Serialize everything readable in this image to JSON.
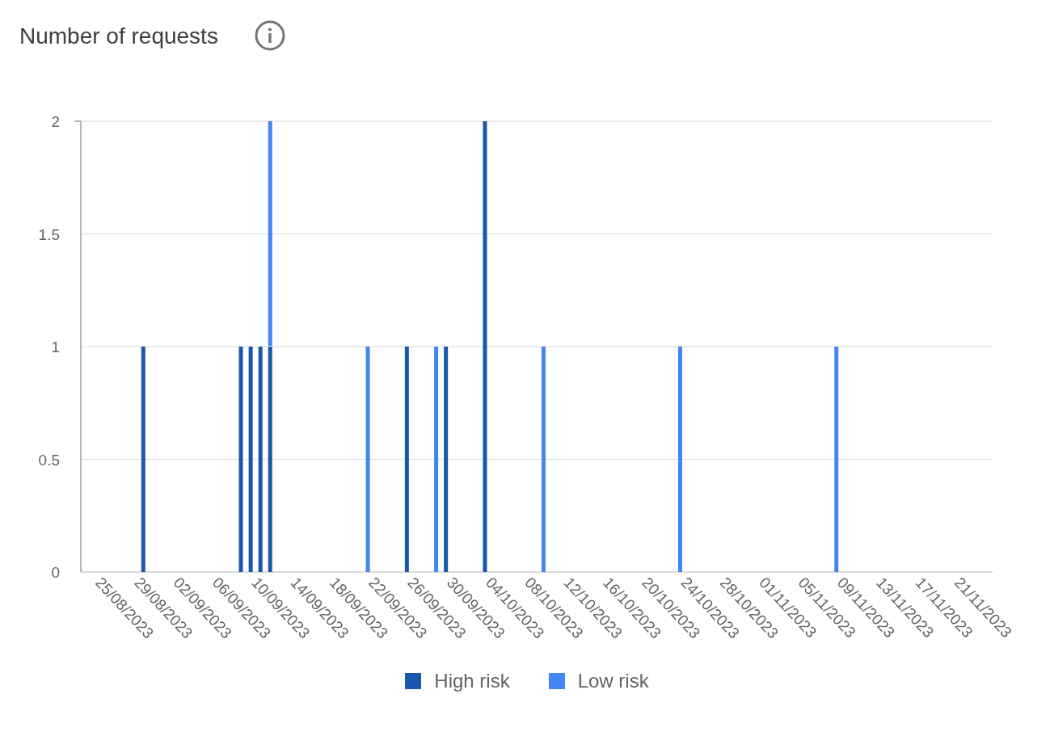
{
  "title": "Number of requests",
  "chart_data": {
    "type": "bar",
    "stacked": true,
    "grid": true,
    "categories": [
      "25/08/2023",
      null,
      null,
      null,
      "29/08/2023",
      null,
      null,
      null,
      "02/09/2023",
      null,
      null,
      null,
      "06/09/2023",
      null,
      null,
      null,
      "10/09/2023",
      null,
      null,
      null,
      "14/09/2023",
      null,
      null,
      null,
      "18/09/2023",
      null,
      null,
      null,
      "22/09/2023",
      null,
      null,
      null,
      "26/09/2023",
      null,
      null,
      null,
      "30/09/2023",
      null,
      null,
      null,
      "04/10/2023",
      null,
      null,
      null,
      "08/10/2023",
      null,
      null,
      null,
      "12/10/2023",
      null,
      null,
      null,
      "16/10/2023",
      null,
      null,
      null,
      "20/10/2023",
      null,
      null,
      null,
      "24/10/2023",
      null,
      null,
      null,
      "28/10/2023",
      null,
      null,
      null,
      "01/11/2023",
      null,
      null,
      null,
      "05/11/2023",
      null,
      null,
      null,
      "09/11/2023",
      null,
      null,
      null,
      "13/11/2023",
      null,
      null,
      null,
      "17/11/2023",
      null,
      null,
      null,
      "21/11/2023",
      null,
      null,
      null
    ],
    "series": [
      {
        "name": "High risk",
        "color": "#1a57ab",
        "values": [
          0,
          0,
          0,
          0,
          0,
          1,
          0,
          0,
          0,
          0,
          0,
          0,
          0,
          0,
          0,
          1,
          1,
          1,
          1,
          0,
          0,
          0,
          0,
          0,
          0,
          0,
          0,
          0,
          0,
          0,
          0,
          0,
          1,
          0,
          0,
          0,
          1,
          0,
          0,
          0,
          2,
          0,
          0,
          0,
          0,
          0,
          0,
          0,
          0,
          0,
          0,
          0,
          0,
          0,
          0,
          0,
          0,
          0,
          0,
          0,
          0,
          0,
          0,
          0,
          0,
          0,
          0,
          0,
          0,
          0,
          0,
          0,
          0,
          0,
          0,
          0,
          0,
          0,
          0,
          0,
          0,
          0,
          0,
          0,
          0,
          0,
          0,
          0,
          0,
          0,
          0,
          0
        ]
      },
      {
        "name": "Low risk",
        "color": "#4285f4",
        "values": [
          0,
          0,
          0,
          0,
          0,
          0,
          0,
          0,
          0,
          0,
          0,
          0,
          0,
          0,
          0,
          0,
          0,
          0,
          1,
          0,
          0,
          0,
          0,
          0,
          0,
          0,
          0,
          0,
          1,
          0,
          0,
          0,
          0,
          0,
          0,
          1,
          0,
          0,
          0,
          0,
          0,
          0,
          0,
          0,
          0,
          0,
          1,
          0,
          0,
          0,
          0,
          0,
          0,
          0,
          0,
          0,
          0,
          0,
          0,
          0,
          1,
          0,
          0,
          0,
          0,
          0,
          0,
          0,
          0,
          0,
          0,
          0,
          0,
          0,
          0,
          0,
          1,
          0,
          0,
          0,
          0,
          0,
          0,
          0,
          0,
          0,
          0,
          0,
          0,
          0,
          0,
          0
        ]
      }
    ],
    "ylim": [
      0,
      2
    ],
    "yticks": [
      0,
      0.5,
      1,
      1.5,
      2
    ]
  }
}
